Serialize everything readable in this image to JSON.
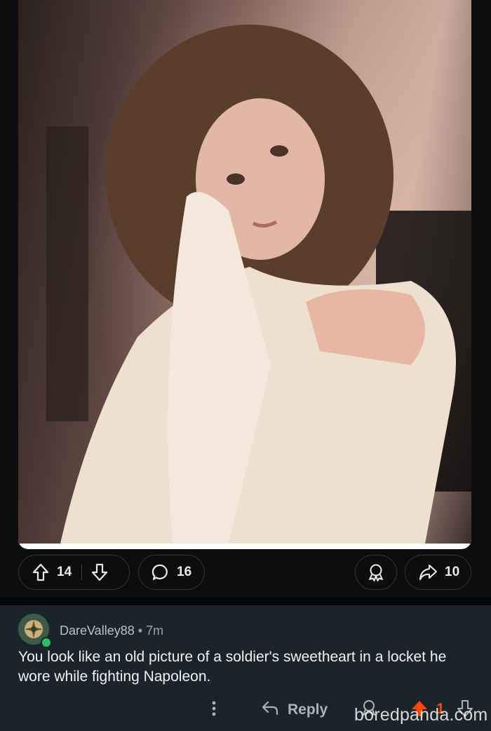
{
  "post": {
    "photo_alt": "selfie",
    "upvote_count": "14",
    "comment_count": "16",
    "share_count": "10"
  },
  "comment": {
    "username": "DareValley88",
    "time": "7m",
    "body": "You look like an old picture of a soldier's sweetheart in a locket he wore while fighting Napoleon.",
    "reply_label": "Reply",
    "score": "1"
  },
  "watermark": "boredpanda.com",
  "icons": {
    "upvote": "arrow-up-outline-icon",
    "downvote": "arrow-down-outline-icon",
    "comment": "speech-bubble-icon",
    "award": "award-ribbon-icon",
    "share": "share-arrow-icon",
    "more": "vertical-dots-icon",
    "reply": "reply-arrow-icon",
    "upvoted": "arrow-up-filled-icon"
  },
  "colors": {
    "background": "#0b0d0f",
    "comment_background": "#1b242a",
    "upvote_active": "#ff4500",
    "online": "#28c06a"
  }
}
